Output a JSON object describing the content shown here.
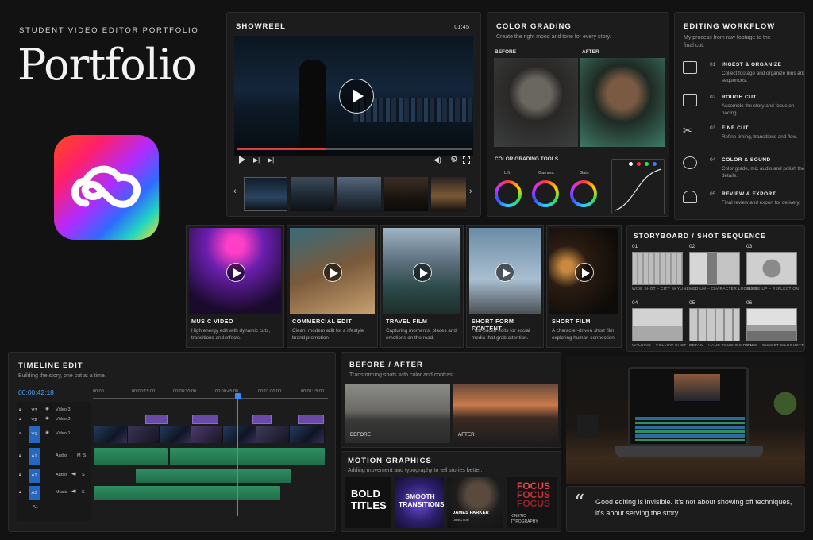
{
  "brand": {
    "kicker": "STUDENT VIDEO EDITOR PORTFOLIO",
    "title": "Portfolio",
    "app_icon": "creative-cloud-icon"
  },
  "showreel": {
    "title": "SHOWREEL",
    "duration": "01:45",
    "progress": 0.38
  },
  "color_grading": {
    "title": "COLOR GRADING",
    "subtitle": "Create the right mood and tone for every story.",
    "before": "BEFORE",
    "after": "AFTER",
    "tools_title": "COLOR GRADING TOOLS",
    "wheels": [
      "Lift",
      "Gamma",
      "Gain"
    ],
    "curve_dots": [
      "#ffffff",
      "#ff3b3b",
      "#33dd55",
      "#3a7bff"
    ]
  },
  "workflow": {
    "title": "EDITING WORKFLOW",
    "subtitle": "My process from raw footage to the final cut.",
    "steps": [
      {
        "num": "01",
        "name": "INGEST & ORGANIZE",
        "desc": "Collect footage and organize bins and sequences.",
        "icon": "folder-icon"
      },
      {
        "num": "02",
        "name": "ROUGH CUT",
        "desc": "Assemble the story and focus on pacing.",
        "icon": "frame-icon"
      },
      {
        "num": "03",
        "name": "FINE CUT",
        "desc": "Refine timing, transitions and flow.",
        "icon": "scissors-icon"
      },
      {
        "num": "04",
        "name": "COLOR & SOUND",
        "desc": "Color grade, mix audio and polish the details.",
        "icon": "color-circles-icon"
      },
      {
        "num": "05",
        "name": "REVIEW & EXPORT",
        "desc": "Final review and export for delivery.",
        "icon": "export-icon"
      }
    ]
  },
  "projects": [
    {
      "title": "MUSIC VIDEO",
      "desc": "High energy edit with dynamic cuts, transitions and effects."
    },
    {
      "title": "COMMERCIAL EDIT",
      "desc": "Clean, modern edit for a lifestyle brand promotion."
    },
    {
      "title": "TRAVEL FILM",
      "desc": "Capturing moments, places and emotions on the road."
    },
    {
      "title": "SHORT FORM CONTENT",
      "desc": "Fast-paced edits for social media that grab attention."
    },
    {
      "title": "SHORT FILM",
      "desc": "A character-driven short film exploring human connection."
    }
  ],
  "storyboard": {
    "title": "STORYBOARD / SHOT SEQUENCE",
    "shots": [
      {
        "num": "01",
        "cap": "WIDE SHOT – CITY SKYLINE"
      },
      {
        "num": "02",
        "cap": "MEDIUM – CHARACTER LOOKING"
      },
      {
        "num": "03",
        "cap": "CLOSE UP – REFLECTION"
      },
      {
        "num": "04",
        "cap": "WALKING – FOLLOW SHOT"
      },
      {
        "num": "05",
        "cap": "DETAIL – HAND TOUCHES RAIL"
      },
      {
        "num": "06",
        "cap": "WIDE – SUNSET SILHOUETTE"
      }
    ]
  },
  "timeline": {
    "title": "TIMELINE EDIT",
    "subtitle": "Building the story, one cut at a time.",
    "timecode": "00:00:42:18",
    "ruler": [
      "00:00",
      "00:00:15:00",
      "00:00:30:00",
      "00:00:45:00",
      "00:01:00:00",
      "00:01:15:00"
    ],
    "tracks": [
      {
        "tag": "V3",
        "name": "Video 3"
      },
      {
        "tag": "V2",
        "name": "Video 2"
      },
      {
        "tag": "V1",
        "name": "Video 1"
      },
      {
        "tag": "A1",
        "name": "Audio",
        "flags": "M  S"
      },
      {
        "tag": "A2",
        "name": "Audio",
        "flags": "S"
      },
      {
        "tag": "A3",
        "name": "Music",
        "flags": "S"
      }
    ],
    "footer_tag": "A1"
  },
  "before_after": {
    "title": "BEFORE / AFTER",
    "subtitle": "Transforming shots with color and contrast.",
    "before": "BEFORE",
    "after": "AFTER"
  },
  "motion": {
    "title": "MOTION GRAPHICS",
    "subtitle": "Adding movement and typography to tell stories better.",
    "tiles": {
      "bold": "BOLD TITLES",
      "smooth": "SMOOTH TRANSITIONS",
      "name": "JAMES PARKER",
      "role": "DIRECTOR",
      "focus": "FOCUS",
      "kinetic": "KINETIC TYPOGRAPHY"
    }
  },
  "quote": {
    "mark": "“",
    "text": "Good editing is invisible. It’s not about showing off techniques, it’s about serving the story."
  }
}
